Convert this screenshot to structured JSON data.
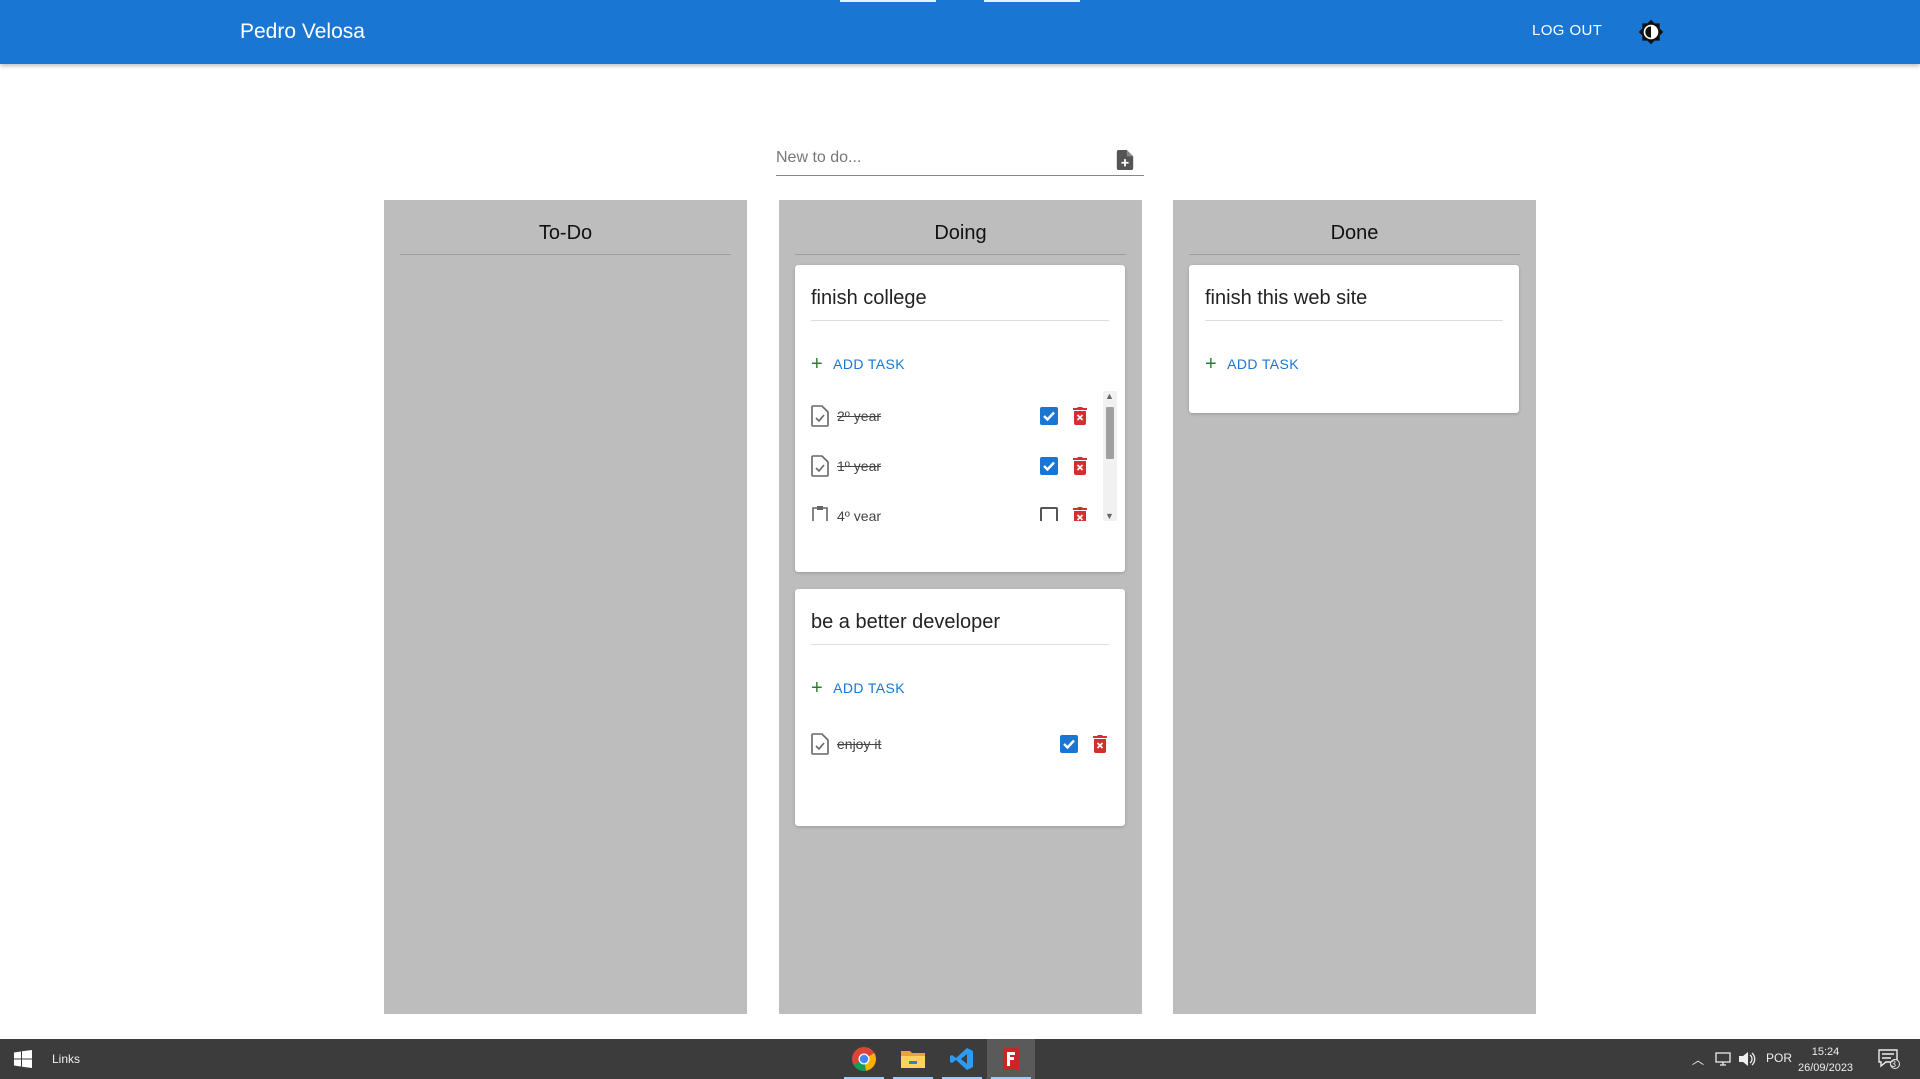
{
  "appbar": {
    "title": "Pedro Velosa",
    "logout_label": "LOG OUT",
    "theme_icon": "brightness-icon",
    "color": "#1976d2"
  },
  "new_todo": {
    "placeholder": "New to do...",
    "value": "",
    "icon": "add-document-icon"
  },
  "columns": [
    {
      "title": "To-Do",
      "cards": []
    },
    {
      "title": "Doing",
      "cards": [
        {
          "title": "finish college",
          "add_task_label": "ADD TASK",
          "tasks": [
            {
              "label": "2º year",
              "checked": true
            },
            {
              "label": "1º year",
              "checked": true
            },
            {
              "label": "4º year",
              "checked": false
            }
          ]
        },
        {
          "title": "be a better developer",
          "add_task_label": "ADD TASK",
          "tasks": [
            {
              "label": "enjoy it",
              "checked": true
            }
          ]
        }
      ]
    },
    {
      "title": "Done",
      "cards": [
        {
          "title": "finish this web site",
          "add_task_label": "ADD TASK",
          "tasks": []
        }
      ]
    }
  ],
  "taskbar": {
    "links_label": "Links",
    "apps": [
      "chrome-icon",
      "file-explorer-icon",
      "vscode-icon",
      "app-icon"
    ],
    "language": "POR",
    "time": "15:24",
    "date": "26/09/2023",
    "notifications": "3"
  }
}
